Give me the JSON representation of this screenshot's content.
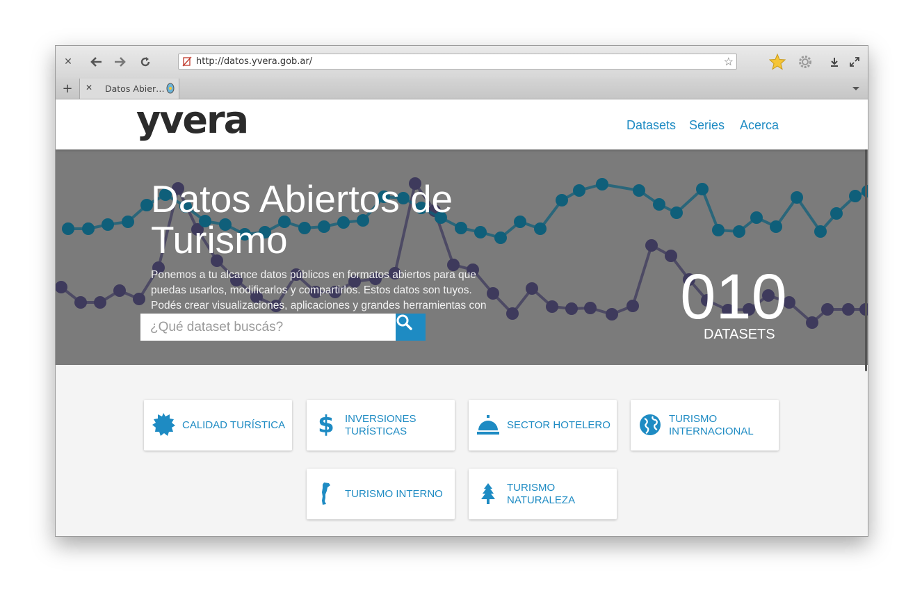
{
  "browser": {
    "url": "http://datos.yvera.gob.ar/",
    "tab_title": "Datos Abier…"
  },
  "site": {
    "logo": "yvera",
    "nav": [
      "Datasets",
      "Series",
      "Acerca"
    ]
  },
  "hero": {
    "title": "Datos Abiertos de Turismo",
    "description": "Ponemos a tu alcance datos públicos en formatos abiertos para que puedas usarlos, modificarlos y compartirlos. Estos datos son tuyos. Podés crear visualizaciones, aplicaciones y grandes herramientas con",
    "search_placeholder": "¿Qué dataset buscás?",
    "count": "010",
    "count_label": "DATASETS"
  },
  "categories": [
    {
      "label": "CALIDAD TURÍSTICA",
      "icon": "badge-icon"
    },
    {
      "label": "INVERSIONES TURÍSTICAS",
      "icon": "dollar-icon"
    },
    {
      "label": "SECTOR HOTELERO",
      "icon": "hotel-bell-icon"
    },
    {
      "label": "TURISMO INTERNACIONAL",
      "icon": "globe-icon"
    },
    {
      "label": "TURISMO INTERNO",
      "icon": "argentina-map-icon"
    },
    {
      "label": "TURISMO NATURALEZA",
      "icon": "tree-icon"
    }
  ],
  "colors": {
    "accent": "#1e8bc3",
    "hero_bg": "#7b7b7b",
    "series_teal": "#0f5f7a",
    "series_purple": "#3e3a5c"
  }
}
